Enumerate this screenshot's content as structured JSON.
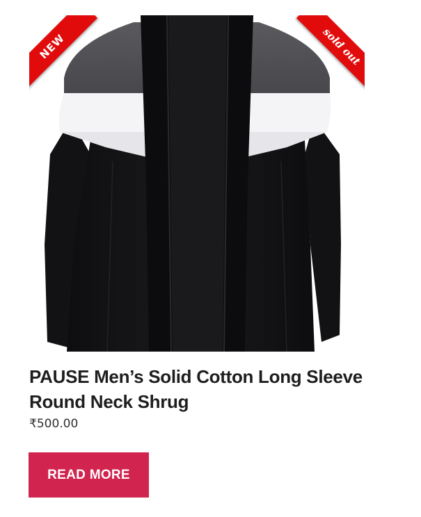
{
  "product": {
    "badge_new": "NEW",
    "badge_sold": "sold out",
    "title": "PAUSE Men’s Solid Cotton Long Sleeve Round Neck Shrug",
    "price": "₹500.00",
    "button_label": "READ MORE",
    "image_icon": "shrug-product-image"
  },
  "colors": {
    "badge": "#e10b0b",
    "button": "#d1244f",
    "title": "#1e1e1e",
    "price": "#2f2f2f"
  }
}
